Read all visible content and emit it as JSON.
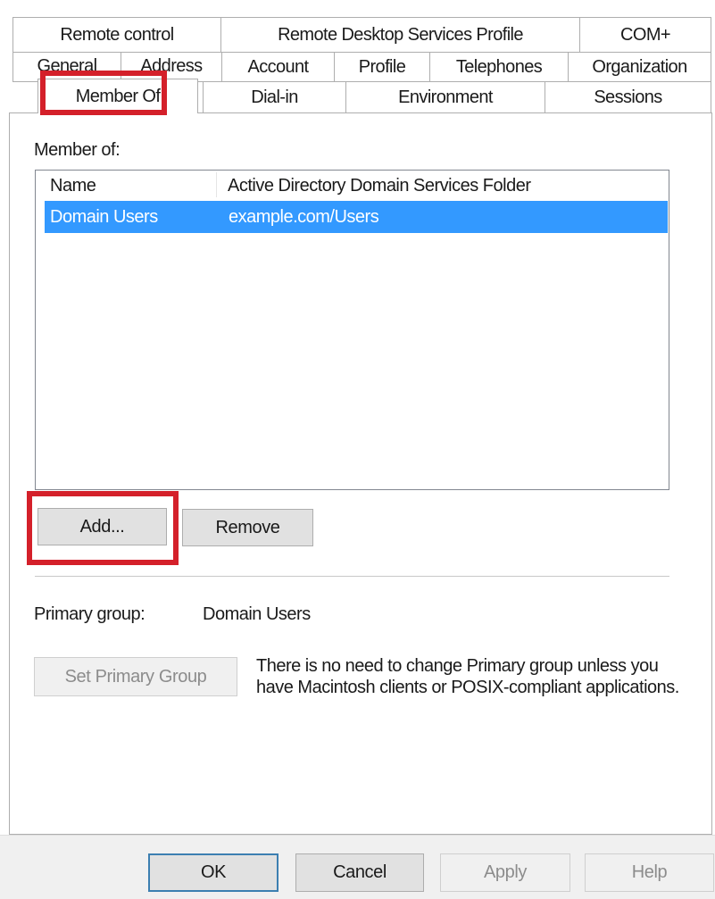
{
  "tabs": {
    "row1": [
      "Remote control",
      "Remote Desktop Services Profile",
      "COM+"
    ],
    "row2": [
      "General",
      "Address",
      "Account",
      "Profile",
      "Telephones",
      "Organization"
    ],
    "row3": [
      "Member Of",
      "Dial-in",
      "Environment",
      "Sessions"
    ]
  },
  "member_of_label": "Member of:",
  "list": {
    "columns": [
      "Name",
      "Active Directory Domain Services Folder"
    ],
    "rows": [
      {
        "name": "Domain Users",
        "folder": "example.com/Users",
        "selected": true
      }
    ]
  },
  "buttons": {
    "add": "Add...",
    "remove": "Remove",
    "set_primary": "Set Primary Group"
  },
  "primary_group": {
    "label": "Primary group:",
    "value": "Domain Users"
  },
  "note": "There is no need to change Primary group unless you have Macintosh clients or POSIX-compliant applications.",
  "footer": {
    "ok": "OK",
    "cancel": "Cancel",
    "apply": "Apply",
    "help": "Help"
  },
  "colors": {
    "highlight": "#d4202a",
    "selection": "#3399ff",
    "selected_text": "#ffffff"
  }
}
